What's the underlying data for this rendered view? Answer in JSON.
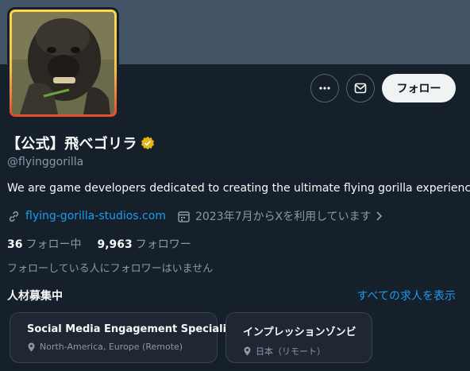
{
  "profile": {
    "display_name": "【公式】飛べゴリラ",
    "handle": "@flyinggorilla",
    "bio": "We are game developers dedicated to creating the ultimate flying gorilla experience.",
    "website": "flying-gorilla-studios.com",
    "joined": "2023年7月からXを利用しています",
    "following_count": "36",
    "following_label": "フォロー中",
    "followers_count": "9,963",
    "followers_label": "フォロワー",
    "no_mutuals": "フォローしている人にフォロワーはいません"
  },
  "actions": {
    "more_icon": "more-horizontal-icon",
    "message_icon": "envelope-icon",
    "follow_label": "フォロー"
  },
  "jobs": {
    "heading": "人材募集中",
    "see_all": "すべての求人を表示",
    "items": [
      {
        "title": "Social Media Engagement Specialist",
        "location": "North-America, Europe (Remote)"
      },
      {
        "title": "インプレッションゾンビ",
        "location": "日本（リモート）"
      }
    ]
  },
  "colors": {
    "background": "#15202b",
    "banner": "#425466",
    "accent": "#1d9bf0",
    "verified_badge": "#e2b719",
    "muted_text": "#8b98a5"
  }
}
